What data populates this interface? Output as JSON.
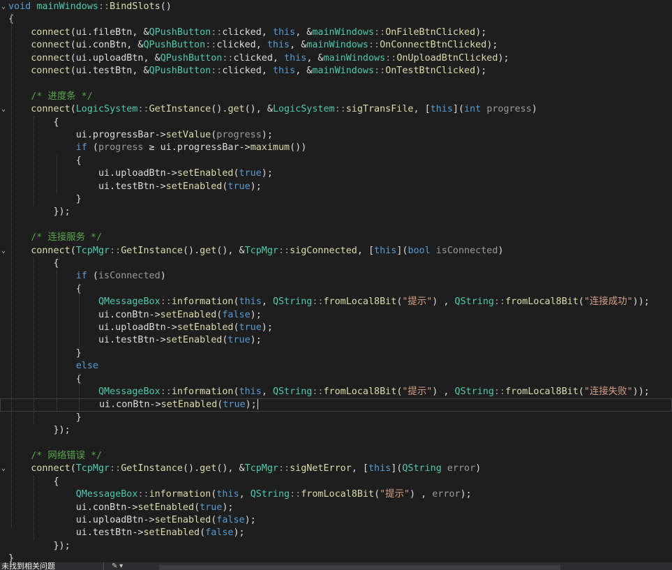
{
  "editor": {
    "lines": [
      [
        [
          "kw",
          "void"
        ],
        [
          "pl",
          " "
        ],
        [
          "ty",
          "mainWindows"
        ],
        [
          "par",
          "::"
        ],
        [
          "fn",
          "BindSlots"
        ],
        [
          "pl",
          "()"
        ]
      ],
      [
        [
          "pl",
          "{"
        ]
      ],
      [
        [
          "pl",
          "    "
        ],
        [
          "fn",
          "connect"
        ],
        [
          "pl",
          "(ui.fileBtn, &"
        ],
        [
          "ty",
          "QPushButton"
        ],
        [
          "par",
          "::"
        ],
        [
          "pl",
          "clicked, "
        ],
        [
          "kw",
          "this"
        ],
        [
          "pl",
          ", &"
        ],
        [
          "ty",
          "mainWindows"
        ],
        [
          "par",
          "::"
        ],
        [
          "fn",
          "OnFileBtnClicked"
        ],
        [
          "pl",
          ");"
        ]
      ],
      [
        [
          "pl",
          "    "
        ],
        [
          "fn",
          "connect"
        ],
        [
          "pl",
          "(ui.conBtn, &"
        ],
        [
          "ty",
          "QPushButton"
        ],
        [
          "par",
          "::"
        ],
        [
          "pl",
          "clicked, "
        ],
        [
          "kw",
          "this"
        ],
        [
          "pl",
          ", &"
        ],
        [
          "ty",
          "mainWindows"
        ],
        [
          "par",
          "::"
        ],
        [
          "fn",
          "OnConnectBtnClicked"
        ],
        [
          "pl",
          ");"
        ]
      ],
      [
        [
          "pl",
          "    "
        ],
        [
          "fn",
          "connect"
        ],
        [
          "pl",
          "(ui.uploadBtn, &"
        ],
        [
          "ty",
          "QPushButton"
        ],
        [
          "par",
          "::"
        ],
        [
          "pl",
          "clicked, "
        ],
        [
          "kw",
          "this"
        ],
        [
          "pl",
          ", &"
        ],
        [
          "ty",
          "mainWindows"
        ],
        [
          "par",
          "::"
        ],
        [
          "fn",
          "OnUploadBtnClicked"
        ],
        [
          "pl",
          ");"
        ]
      ],
      [
        [
          "pl",
          "    "
        ],
        [
          "fn",
          "connect"
        ],
        [
          "pl",
          "(ui.testBtn, &"
        ],
        [
          "ty",
          "QPushButton"
        ],
        [
          "par",
          "::"
        ],
        [
          "pl",
          "clicked, "
        ],
        [
          "kw",
          "this"
        ],
        [
          "pl",
          ", &"
        ],
        [
          "ty",
          "mainWindows"
        ],
        [
          "par",
          "::"
        ],
        [
          "fn",
          "OnTestBtnClicked"
        ],
        [
          "pl",
          ");"
        ]
      ],
      [
        [
          "pl",
          ""
        ]
      ],
      [
        [
          "pl",
          "    "
        ],
        [
          "cm",
          "/* 进度条 */"
        ]
      ],
      [
        [
          "pl",
          "    "
        ],
        [
          "fn",
          "connect"
        ],
        [
          "pl",
          "("
        ],
        [
          "ty",
          "LogicSystem"
        ],
        [
          "par",
          "::"
        ],
        [
          "fn",
          "GetInstance"
        ],
        [
          "pl",
          "()."
        ],
        [
          "fn",
          "get"
        ],
        [
          "pl",
          "(), &"
        ],
        [
          "ty",
          "LogicSystem"
        ],
        [
          "par",
          "::"
        ],
        [
          "fn",
          "sigTransFile"
        ],
        [
          "pl",
          ", ["
        ],
        [
          "kw",
          "this"
        ],
        [
          "pl",
          "]("
        ],
        [
          "kw",
          "int"
        ],
        [
          "pl",
          " "
        ],
        [
          "par",
          "progress"
        ],
        [
          "pl",
          ")"
        ]
      ],
      [
        [
          "pl",
          "        {"
        ]
      ],
      [
        [
          "pl",
          "            ui.progressBar->"
        ],
        [
          "fn",
          "setValue"
        ],
        [
          "pl",
          "("
        ],
        [
          "par",
          "progress"
        ],
        [
          "pl",
          ");"
        ]
      ],
      [
        [
          "pl",
          "            "
        ],
        [
          "kw",
          "if"
        ],
        [
          "pl",
          " ("
        ],
        [
          "par",
          "progress"
        ],
        [
          "pl",
          " ≥ ui.progressBar->"
        ],
        [
          "fn",
          "maximum"
        ],
        [
          "pl",
          "())"
        ]
      ],
      [
        [
          "pl",
          "            {"
        ]
      ],
      [
        [
          "pl",
          "                ui.uploadBtn->"
        ],
        [
          "fn",
          "setEnabled"
        ],
        [
          "pl",
          "("
        ],
        [
          "kw",
          "true"
        ],
        [
          "pl",
          ");"
        ]
      ],
      [
        [
          "pl",
          "                ui.testBtn->"
        ],
        [
          "fn",
          "setEnabled"
        ],
        [
          "pl",
          "("
        ],
        [
          "kw",
          "true"
        ],
        [
          "pl",
          ");"
        ]
      ],
      [
        [
          "pl",
          "            }"
        ]
      ],
      [
        [
          "pl",
          "        });"
        ]
      ],
      [
        [
          "pl",
          ""
        ]
      ],
      [
        [
          "pl",
          "    "
        ],
        [
          "cm",
          "/* 连接服务 */"
        ]
      ],
      [
        [
          "pl",
          "    "
        ],
        [
          "fn",
          "connect"
        ],
        [
          "pl",
          "("
        ],
        [
          "ty",
          "TcpMgr"
        ],
        [
          "par",
          "::"
        ],
        [
          "fn",
          "GetInstance"
        ],
        [
          "pl",
          "()."
        ],
        [
          "fn",
          "get"
        ],
        [
          "pl",
          "(), &"
        ],
        [
          "ty",
          "TcpMgr"
        ],
        [
          "par",
          "::"
        ],
        [
          "fn",
          "sigConnected"
        ],
        [
          "pl",
          ", ["
        ],
        [
          "kw",
          "this"
        ],
        [
          "pl",
          "]("
        ],
        [
          "kw",
          "bool"
        ],
        [
          "pl",
          " "
        ],
        [
          "par",
          "isConnected"
        ],
        [
          "pl",
          ")"
        ]
      ],
      [
        [
          "pl",
          "        {"
        ]
      ],
      [
        [
          "pl",
          "            "
        ],
        [
          "kw",
          "if"
        ],
        [
          "pl",
          " ("
        ],
        [
          "par",
          "isConnected"
        ],
        [
          "pl",
          ")"
        ]
      ],
      [
        [
          "pl",
          "            {"
        ]
      ],
      [
        [
          "pl",
          "                "
        ],
        [
          "ty",
          "QMessageBox"
        ],
        [
          "par",
          "::"
        ],
        [
          "fn",
          "information"
        ],
        [
          "pl",
          "("
        ],
        [
          "kw",
          "this"
        ],
        [
          "pl",
          ", "
        ],
        [
          "ty",
          "QString"
        ],
        [
          "par",
          "::"
        ],
        [
          "fn",
          "fromLocal8Bit"
        ],
        [
          "pl",
          "("
        ],
        [
          "str",
          "\"提示\""
        ],
        [
          "pl",
          ") , "
        ],
        [
          "ty",
          "QString"
        ],
        [
          "par",
          "::"
        ],
        [
          "fn",
          "fromLocal8Bit"
        ],
        [
          "pl",
          "("
        ],
        [
          "str",
          "\"连接成功\""
        ],
        [
          "pl",
          "));"
        ]
      ],
      [
        [
          "pl",
          "                ui.conBtn->"
        ],
        [
          "fn",
          "setEnabled"
        ],
        [
          "pl",
          "("
        ],
        [
          "kw",
          "false"
        ],
        [
          "pl",
          ");"
        ]
      ],
      [
        [
          "pl",
          "                ui.uploadBtn->"
        ],
        [
          "fn",
          "setEnabled"
        ],
        [
          "pl",
          "("
        ],
        [
          "kw",
          "true"
        ],
        [
          "pl",
          ");"
        ]
      ],
      [
        [
          "pl",
          "                ui.testBtn->"
        ],
        [
          "fn",
          "setEnabled"
        ],
        [
          "pl",
          "("
        ],
        [
          "kw",
          "true"
        ],
        [
          "pl",
          ");"
        ]
      ],
      [
        [
          "pl",
          "            }"
        ]
      ],
      [
        [
          "pl",
          "            "
        ],
        [
          "kw",
          "else"
        ]
      ],
      [
        [
          "pl",
          "            {"
        ]
      ],
      [
        [
          "pl",
          "                "
        ],
        [
          "ty",
          "QMessageBox"
        ],
        [
          "par",
          "::"
        ],
        [
          "fn",
          "information"
        ],
        [
          "pl",
          "("
        ],
        [
          "kw",
          "this"
        ],
        [
          "pl",
          ", "
        ],
        [
          "ty",
          "QString"
        ],
        [
          "par",
          "::"
        ],
        [
          "fn",
          "fromLocal8Bit"
        ],
        [
          "pl",
          "("
        ],
        [
          "str",
          "\"提示\""
        ],
        [
          "pl",
          ") , "
        ],
        [
          "ty",
          "QString"
        ],
        [
          "par",
          "::"
        ],
        [
          "fn",
          "fromLocal8Bit"
        ],
        [
          "pl",
          "("
        ],
        [
          "str",
          "\"连接失败\""
        ],
        [
          "pl",
          "));"
        ]
      ],
      [
        [
          "pl",
          "                ui.conBtn->"
        ],
        [
          "fn",
          "setEnabled"
        ],
        [
          "pl",
          "("
        ],
        [
          "kw",
          "true"
        ],
        [
          "pl",
          ");"
        ]
      ],
      [
        [
          "pl",
          "            }"
        ]
      ],
      [
        [
          "pl",
          "        });"
        ]
      ],
      [
        [
          "pl",
          ""
        ]
      ],
      [
        [
          "pl",
          "    "
        ],
        [
          "cm",
          "/* 网络错误 */"
        ]
      ],
      [
        [
          "pl",
          "    "
        ],
        [
          "fn",
          "connect"
        ],
        [
          "pl",
          "("
        ],
        [
          "ty",
          "TcpMgr"
        ],
        [
          "par",
          "::"
        ],
        [
          "fn",
          "GetInstance"
        ],
        [
          "pl",
          "()."
        ],
        [
          "fn",
          "get"
        ],
        [
          "pl",
          "(), &"
        ],
        [
          "ty",
          "TcpMgr"
        ],
        [
          "par",
          "::"
        ],
        [
          "fn",
          "sigNetError"
        ],
        [
          "pl",
          ", ["
        ],
        [
          "kw",
          "this"
        ],
        [
          "pl",
          "]("
        ],
        [
          "ty",
          "QString"
        ],
        [
          "pl",
          " "
        ],
        [
          "par",
          "error"
        ],
        [
          "pl",
          ")"
        ]
      ],
      [
        [
          "pl",
          "        {"
        ]
      ],
      [
        [
          "pl",
          "            "
        ],
        [
          "ty",
          "QMessageBox"
        ],
        [
          "par",
          "::"
        ],
        [
          "fn",
          "information"
        ],
        [
          "pl",
          "("
        ],
        [
          "kw",
          "this"
        ],
        [
          "pl",
          ", "
        ],
        [
          "ty",
          "QString"
        ],
        [
          "par",
          "::"
        ],
        [
          "fn",
          "fromLocal8Bit"
        ],
        [
          "pl",
          "("
        ],
        [
          "str",
          "\"提示\""
        ],
        [
          "pl",
          ") , "
        ],
        [
          "par",
          "error"
        ],
        [
          "pl",
          ");"
        ]
      ],
      [
        [
          "pl",
          "            ui.conBtn->"
        ],
        [
          "fn",
          "setEnabled"
        ],
        [
          "pl",
          "("
        ],
        [
          "kw",
          "true"
        ],
        [
          "pl",
          ");"
        ]
      ],
      [
        [
          "pl",
          "            ui.uploadBtn->"
        ],
        [
          "fn",
          "setEnabled"
        ],
        [
          "pl",
          "("
        ],
        [
          "kw",
          "false"
        ],
        [
          "pl",
          ");"
        ]
      ],
      [
        [
          "pl",
          "            ui.testBtn->"
        ],
        [
          "fn",
          "setEnabled"
        ],
        [
          "pl",
          "("
        ],
        [
          "kw",
          "false"
        ],
        [
          "pl",
          ");"
        ]
      ],
      [
        [
          "pl",
          "        });"
        ]
      ],
      [
        [
          "pl",
          "}"
        ]
      ]
    ]
  },
  "colors": {
    "background": "#1e1e1e",
    "keyword": "#569cd6",
    "function": "#dcdcaa",
    "type": "#4ec9b0",
    "comment": "#57a64a",
    "string": "#d69d85",
    "parameter": "#9a9a9a",
    "plain": "#dcdcdc"
  },
  "statusbar": {
    "issues_label": "未找到相关问题",
    "tool_icon": "brush-icon"
  }
}
